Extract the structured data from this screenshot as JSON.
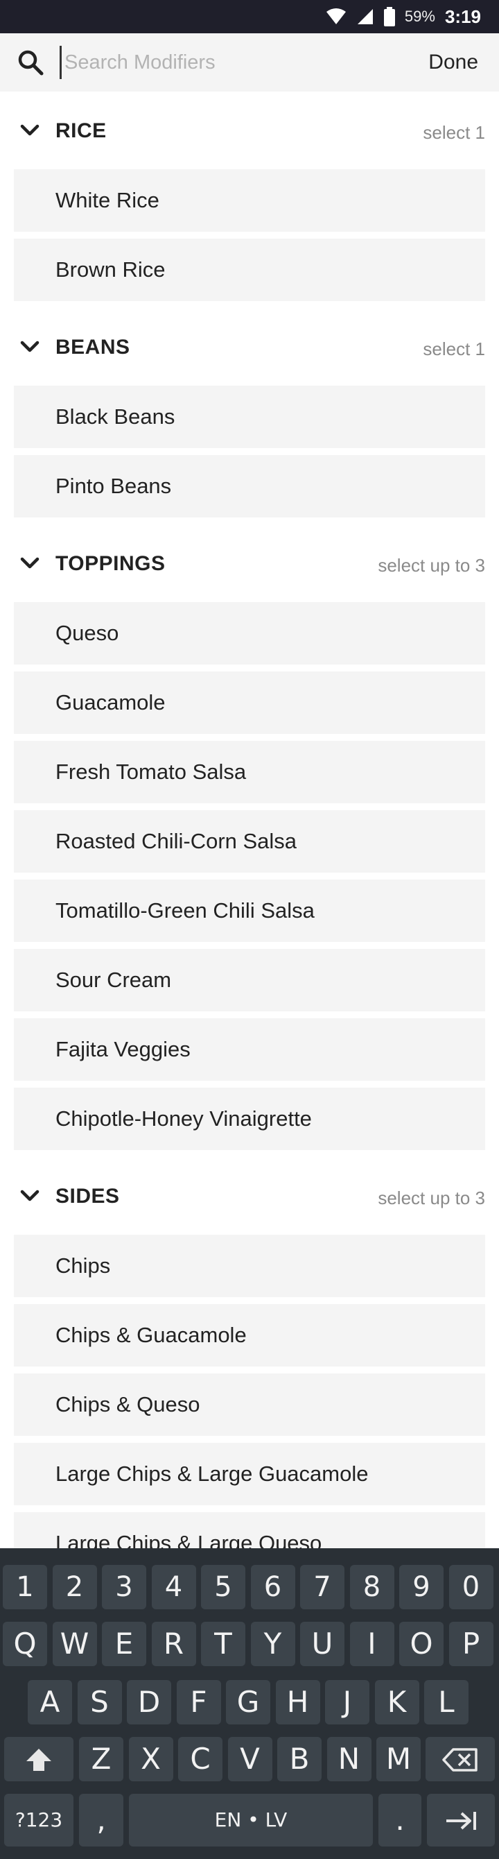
{
  "status_bar": {
    "battery_percent": "59%",
    "time": "3:19"
  },
  "search": {
    "placeholder": "Search Modifiers",
    "value": "",
    "done_label": "Done"
  },
  "groups": [
    {
      "title": "RICE",
      "hint": "select 1",
      "items": [
        "White Rice",
        "Brown Rice"
      ]
    },
    {
      "title": "BEANS",
      "hint": "select 1",
      "items": [
        "Black Beans",
        "Pinto Beans"
      ]
    },
    {
      "title": "TOPPINGS",
      "hint": "select up to 3",
      "items": [
        "Queso",
        "Guacamole",
        "Fresh Tomato Salsa",
        "Roasted Chili-Corn Salsa",
        "Tomatillo-Green Chili Salsa",
        "Sour Cream",
        "Fajita Veggies",
        "Chipotle-Honey Vinaigrette"
      ]
    },
    {
      "title": "SIDES",
      "hint": "select up to 3",
      "items": [
        "Chips",
        "Chips & Guacamole",
        "Chips & Queso",
        "Large Chips & Large Guacamole",
        "Large Chips & Large Queso"
      ]
    }
  ],
  "keyboard": {
    "number_row": [
      "1",
      "2",
      "3",
      "4",
      "5",
      "6",
      "7",
      "8",
      "9",
      "0"
    ],
    "row1": [
      "Q",
      "W",
      "E",
      "R",
      "T",
      "Y",
      "U",
      "I",
      "O",
      "P"
    ],
    "row2": [
      "A",
      "S",
      "D",
      "F",
      "G",
      "H",
      "J",
      "K",
      "L"
    ],
    "row3": [
      "Z",
      "X",
      "C",
      "V",
      "B",
      "N",
      "M"
    ],
    "symbols_label": "?123",
    "comma_label": ",",
    "space_label": "EN • LV",
    "period_label": ".",
    "icons": {
      "shift": "shift-icon",
      "backspace": "backspace-icon",
      "enter": "tab-enter-icon"
    }
  }
}
